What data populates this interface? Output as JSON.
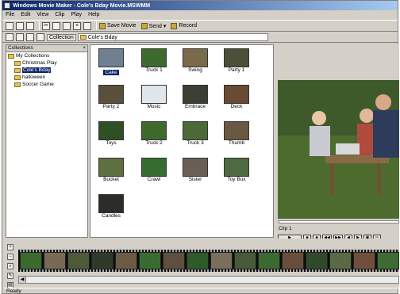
{
  "window": {
    "title": "Windows Movie Maker - Cole's Bday Movie.MSWMM"
  },
  "menu": [
    "File",
    "Edit",
    "View",
    "Clip",
    "Play",
    "Help"
  ],
  "toolbar": {
    "save_movie": "Save Movie",
    "send": "Send ▾",
    "record": "Record"
  },
  "location": {
    "label": "Collection",
    "value": "Cole's Bday"
  },
  "collections": {
    "title": "Collections",
    "close": "×",
    "root": "My Collections",
    "items": [
      "Christmas Play",
      "Cole's Bday",
      "halloween",
      "Soccer Game"
    ],
    "selected_index": 1
  },
  "clips": [
    {
      "label": "Cake",
      "color": "#6f8090"
    },
    {
      "label": "Truck 1",
      "color": "#3d6a2d"
    },
    {
      "label": "Swing",
      "color": "#7b6a4a"
    },
    {
      "label": "Party 1",
      "color": "#4c5038"
    },
    {
      "label": "Party 2",
      "color": "#5a4f3a"
    },
    {
      "label": "Music",
      "color": "#dfe6ec"
    },
    {
      "label": "Embrace",
      "color": "#3a3f33"
    },
    {
      "label": "Deck",
      "color": "#6a4a32"
    },
    {
      "label": "Toys",
      "color": "#2f4f25"
    },
    {
      "label": "Truck 2",
      "color": "#3f6a2f"
    },
    {
      "label": "Truck 3",
      "color": "#4b6a36"
    },
    {
      "label": "Thumb",
      "color": "#6b5842"
    },
    {
      "label": "Bucket",
      "color": "#5e7040"
    },
    {
      "label": "Crawl",
      "color": "#356d30"
    },
    {
      "label": "Sister",
      "color": "#6a5e55"
    },
    {
      "label": "Toy Box",
      "color": "#4e6a40"
    },
    {
      "label": "Candles",
      "color": "#2e2c28"
    }
  ],
  "monitor": {
    "clip_name": "Clip 1",
    "controls": [
      "▶",
      "■",
      "■",
      "◀◀",
      "▶▶",
      "◀",
      "▶",
      "▣",
      "✂"
    ]
  },
  "timeline": {
    "tools": [
      "+",
      "−",
      "⌕",
      "✎",
      "▤"
    ],
    "frames": [
      "#3b6a2e",
      "#7a6a55",
      "#4d5a3a",
      "#2f3a2a",
      "#6c5a44",
      "#3a6b32",
      "#5e4f3f",
      "#2d5a28",
      "#7b6e5b",
      "#485a3a",
      "#3a6a30",
      "#6a4e3c",
      "#2e4a28",
      "#5a6a45",
      "#704f3c",
      "#3d6c33"
    ]
  },
  "status": {
    "text": "Ready"
  }
}
